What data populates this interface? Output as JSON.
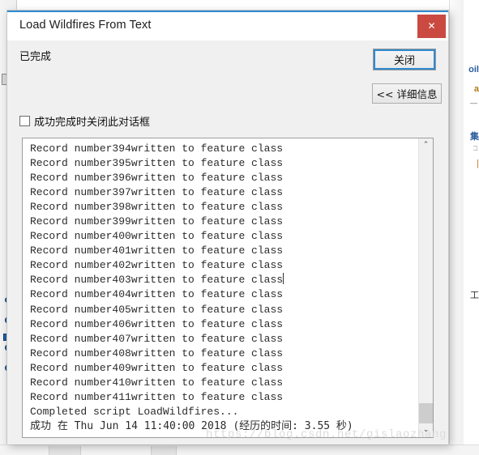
{
  "background": {
    "fragments": [
      "oil",
      "a",
      "—",
      "集",
      "□",
      "工",
      "|"
    ]
  },
  "dialog": {
    "title": "Load Wildfires From Text",
    "close_icon": "close-icon",
    "close_icon_glyph": "✕",
    "accent_color": "#2e8ad0",
    "close_button_color": "#ca4a41",
    "status": "已完成",
    "buttons": {
      "close_label": "关闭",
      "details_label": "<< 详细信息"
    },
    "checkbox": {
      "label": "成功完成时关闭此对话框",
      "checked": false
    },
    "scrollbar": {
      "up_arrow": "⌃",
      "down_arrow": "⌄"
    },
    "log_lines": [
      "Record number394written to feature class",
      "Record number395written to feature class",
      "Record number396written to feature class",
      "Record number397written to feature class",
      "Record number398written to feature class",
      "Record number399written to feature class",
      "Record number400written to feature class",
      "Record number401written to feature class",
      "Record number402written to feature class",
      "Record number403written to feature class",
      "Record number404written to feature class",
      "Record number405written to feature class",
      "Record number406written to feature class",
      "Record number407written to feature class",
      "Record number408written to feature class",
      "Record number409written to feature class",
      "Record number410written to feature class",
      "Record number411written to feature class",
      "Completed script LoadWildfires...",
      "成功 在 Thu Jun 14 11:40:00 2018 (经历的时间: 3.55 秒)"
    ],
    "caret_line_index": 9
  },
  "watermark": "https://blog.csdn.net/gislaozhang"
}
